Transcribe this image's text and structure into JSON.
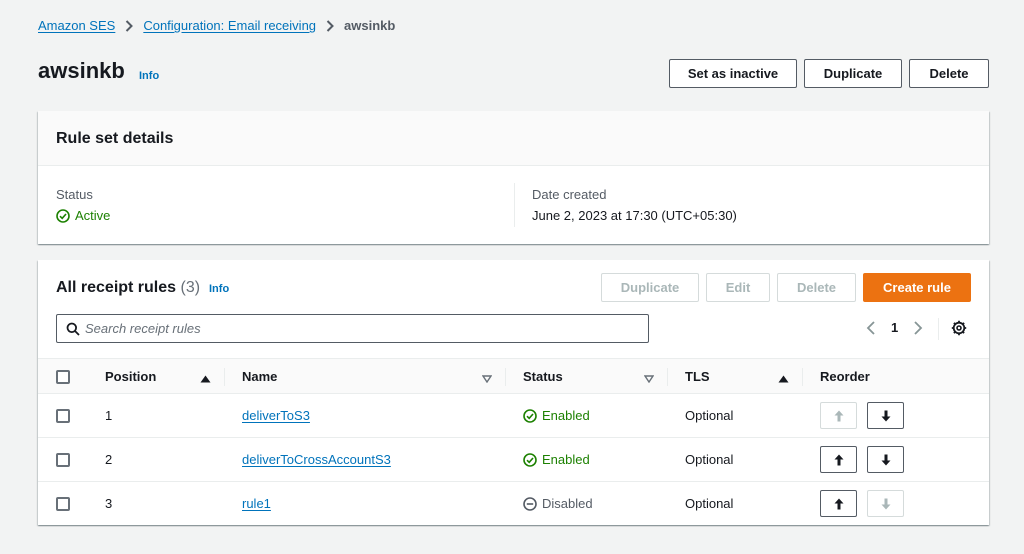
{
  "breadcrumb": {
    "items": [
      "Amazon SES",
      "Configuration: Email receiving"
    ],
    "current": "awsinkb"
  },
  "page": {
    "title": "awsinkb",
    "info": "Info",
    "actions": {
      "set_inactive": "Set as inactive",
      "duplicate": "Duplicate",
      "delete": "Delete"
    }
  },
  "rule_set_details": {
    "heading": "Rule set details",
    "status_label": "Status",
    "status_value": "Active",
    "date_label": "Date created",
    "date_value": "June 2, 2023 at 17:30 (UTC+05:30)"
  },
  "receipt_rules": {
    "heading": "All receipt rules",
    "count": "(3)",
    "info": "Info",
    "actions": {
      "duplicate": "Duplicate",
      "edit": "Edit",
      "delete": "Delete",
      "create": "Create rule"
    },
    "search_placeholder": "Search receipt rules",
    "page": "1",
    "columns": {
      "position": "Position",
      "name": "Name",
      "status": "Status",
      "tls": "TLS",
      "reorder": "Reorder"
    },
    "rows": [
      {
        "position": "1",
        "name": "deliverToS3",
        "status": "Enabled",
        "tls": "Optional",
        "up_enabled": false,
        "down_enabled": true
      },
      {
        "position": "2",
        "name": "deliverToCrossAccountS3",
        "status": "Enabled",
        "tls": "Optional",
        "up_enabled": true,
        "down_enabled": true
      },
      {
        "position": "3",
        "name": "rule1",
        "status": "Disabled",
        "tls": "Optional",
        "up_enabled": true,
        "down_enabled": false
      }
    ]
  },
  "colors": {
    "link": "#0073bb",
    "primary": "#ec7211",
    "success": "#1d8102",
    "text": "#16191f"
  }
}
